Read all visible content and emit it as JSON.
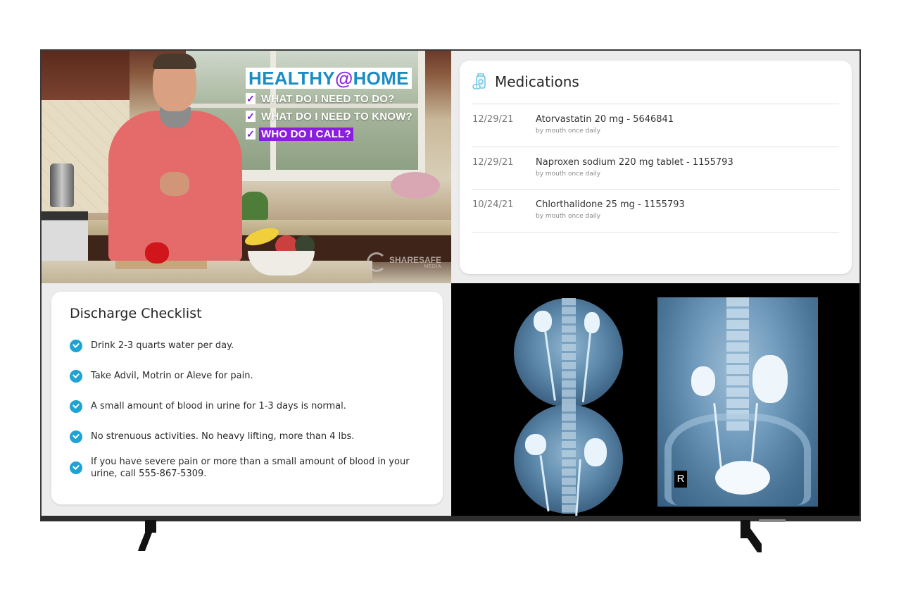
{
  "video": {
    "promo_title_prefix": "HEALTHY",
    "promo_title_at": "@",
    "promo_title_suffix": "HOME",
    "check_mark": "✓",
    "lines": [
      {
        "text": "WHAT DO I NEED TO DO?",
        "highlighted": false
      },
      {
        "text": "WHAT DO I NEED TO KNOW?",
        "highlighted": false
      },
      {
        "text": "WHO DO I CALL?",
        "highlighted": true
      }
    ],
    "watermark_brand": "SHARESAFE",
    "watermark_sub": "MEDIA"
  },
  "medications": {
    "title": "Medications",
    "icon": "medicine-bottle-icon",
    "items": [
      {
        "date": "12/29/21",
        "name": "Atorvastatin 20 mg - 5646841",
        "directions": "by mouth once daily"
      },
      {
        "date": "12/29/21",
        "name": "Naproxen sodium 220 mg tablet - 1155793",
        "directions": "by mouth once daily"
      },
      {
        "date": "10/24/21",
        "name": "Chlorthalidone 25 mg - 1155793",
        "directions": "by mouth once daily"
      }
    ]
  },
  "checklist": {
    "title": "Discharge Checklist",
    "icon": "check-circle-icon",
    "accent_color": "#1fa3d4",
    "items": [
      "Drink 2-3 quarts water per day.",
      "Take Advil, Motrin or Aleve for pain.",
      "A small amount of blood in urine for 1-3 days is normal.",
      "No strenuous activities. No heavy lifting, more than 4 lbs.",
      "If you have severe pain or more than a small amount of blood in your urine, call 555-867-5309."
    ]
  },
  "xray": {
    "marker_label": "R"
  },
  "colors": {
    "promo_blue": "#1b8cc4",
    "promo_purple": "#8a1ee0"
  }
}
